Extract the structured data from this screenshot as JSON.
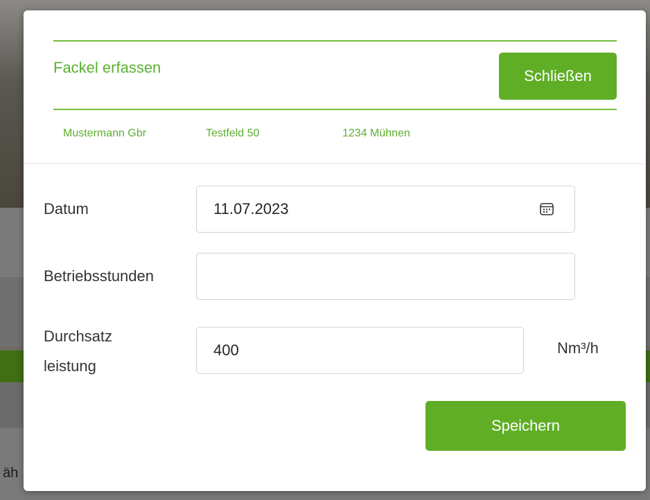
{
  "backdrop": {
    "partial_text": "äh"
  },
  "modal": {
    "title": "Fackel erfassen",
    "close_label": "Schließen",
    "address": {
      "name": "Mustermann Gbr",
      "street": "Testfeld 50",
      "city": "1234 Mühnen"
    },
    "fields": {
      "date": {
        "label": "Datum",
        "value": "11.07.2023",
        "icon": "calendar-icon"
      },
      "hours": {
        "label": "Betriebsstunden",
        "value": ""
      },
      "rate": {
        "label_line1": "Durchsatz",
        "label_line2": "leistung",
        "value": "400",
        "unit": "Nm³/h"
      }
    },
    "save_label": "Speichern"
  },
  "colors": {
    "accent": "#5fae26",
    "accent_text": "#5cb030",
    "rule": "#76bd3e"
  }
}
